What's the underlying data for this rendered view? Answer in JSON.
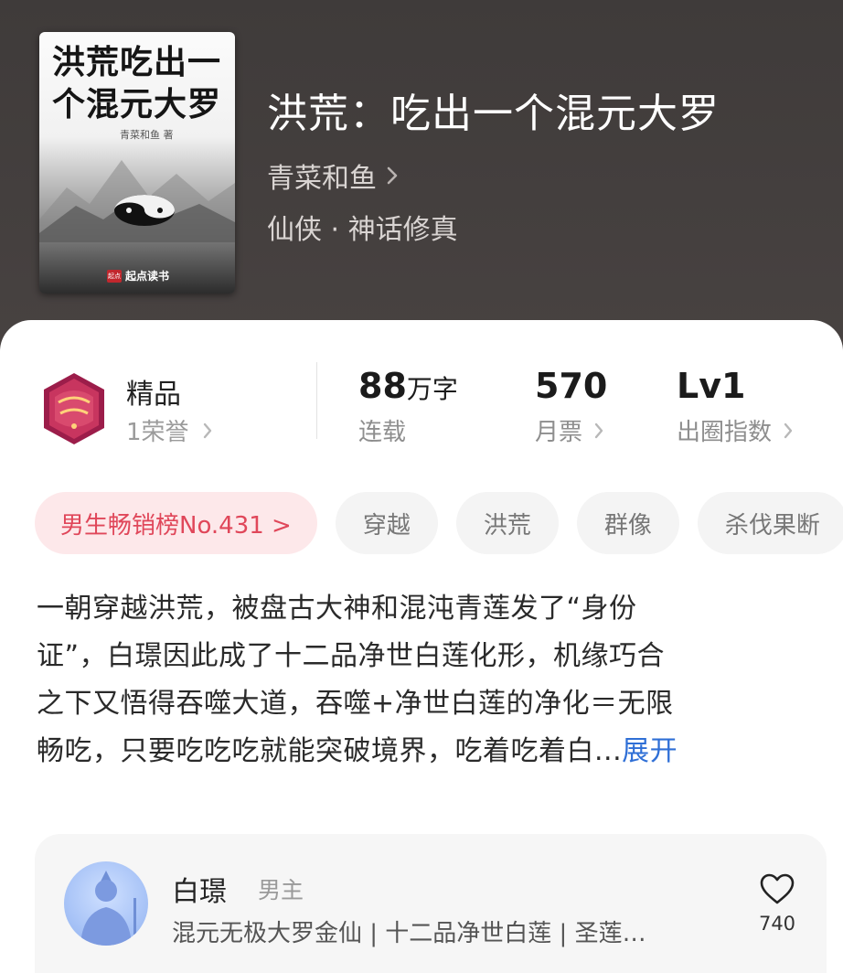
{
  "book": {
    "title": "洪荒：吃出一个混元大罗",
    "author": "青菜和鱼",
    "genre": "仙侠 · 神话修真",
    "cover": {
      "title_line1": "洪荒吃出一",
      "title_line2": "个混元大罗",
      "author_small": "青菜和鱼 著",
      "publisher": "起点读书",
      "publisher_logo": "起点"
    }
  },
  "stats": {
    "premium": {
      "title": "精品",
      "honor": "1荣誉"
    },
    "word_count": {
      "value": "88",
      "unit": "万字",
      "label": "连载"
    },
    "monthly_tickets": {
      "value": "570",
      "label": "月票"
    },
    "circle_index": {
      "value": "Lv1",
      "label": "出圈指数"
    }
  },
  "tags": [
    "男生畅销榜No.431 >",
    "穿越",
    "洪荒",
    "群像",
    "杀伐果断"
  ],
  "description": {
    "lines": [
      "一朝穿越洪荒，被盘古大神和混沌青莲发了“身份",
      "证”，白璟因此成了十二品净世白莲化形，机缘巧合",
      "之下又悟得吞噬大道，吞噬+净世白莲的净化＝无限",
      "畅吃，只要吃吃吃就能突破境界，吃着吃着白..."
    ],
    "expand_label": "展开"
  },
  "character": {
    "name": "白璟",
    "role": "男主",
    "description": "混元无极大罗金仙 | 十二品净世白莲 | 圣莲…",
    "likes": "740"
  },
  "icons": {
    "chevron": "chevron-right-icon",
    "heart": "heart-icon"
  },
  "colors": {
    "accent_blue": "#2f6fd6",
    "rank_tag_text": "#e0475a",
    "rank_tag_bg": "#fde8ea"
  }
}
